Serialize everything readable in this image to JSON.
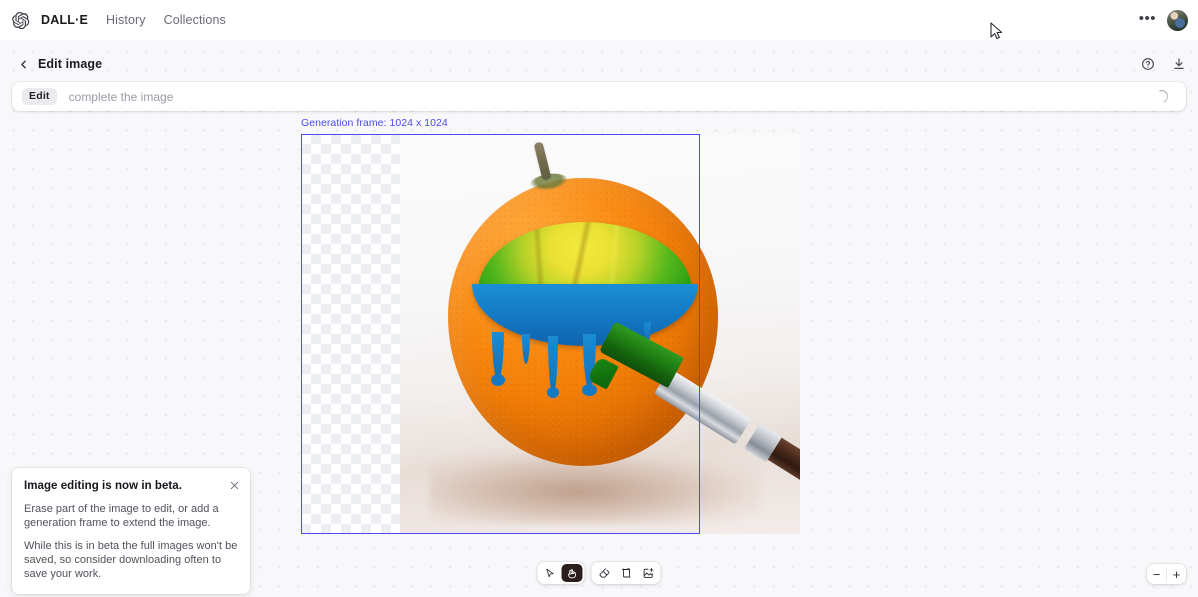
{
  "topnav": {
    "logo_icon": "openai-logo-icon",
    "brand": "DALL·E",
    "links": [
      {
        "label": "History"
      },
      {
        "label": "Collections"
      }
    ],
    "more_label": "•••",
    "avatar_icon": "avatar"
  },
  "subheader": {
    "back_icon": "chevron-left-icon",
    "title": "Edit image",
    "help_icon": "help-circle-icon",
    "download_icon": "download-icon"
  },
  "prompt": {
    "chip_label": "Edit",
    "placeholder": "complete the image",
    "value": "",
    "loading": true,
    "spinner_icon": "loading-spinner-icon"
  },
  "canvas": {
    "frame_label": "Generation frame: 1024 x 1024",
    "frame_color": "#4b4bef",
    "frame_width": 1024,
    "frame_height": 1024,
    "image_alt": "orange fruit with green yellow and blue paint being applied by a paintbrush"
  },
  "toast": {
    "title": "Image editing is now in beta.",
    "paragraph1": "Erase part of the image to edit, or add a generation frame to extend the image.",
    "paragraph2": "While this is in beta the full images won't be saved, so consider downloading often to save your work.",
    "close_icon": "close-icon"
  },
  "toolbar": {
    "groups": [
      {
        "tools": [
          {
            "name": "select-tool",
            "icon": "cursor-arrow-icon",
            "active": false
          },
          {
            "name": "hand-tool",
            "icon": "hand-icon",
            "active": true
          }
        ]
      },
      {
        "tools": [
          {
            "name": "eraser-tool",
            "icon": "eraser-icon",
            "active": false
          },
          {
            "name": "generation-frame-tool",
            "icon": "crop-frame-icon",
            "active": false
          },
          {
            "name": "add-image-tool",
            "icon": "add-image-icon",
            "active": false
          }
        ]
      }
    ]
  },
  "zoom_controls": {
    "zoom_out_label": "−",
    "zoom_in_label": "+"
  }
}
